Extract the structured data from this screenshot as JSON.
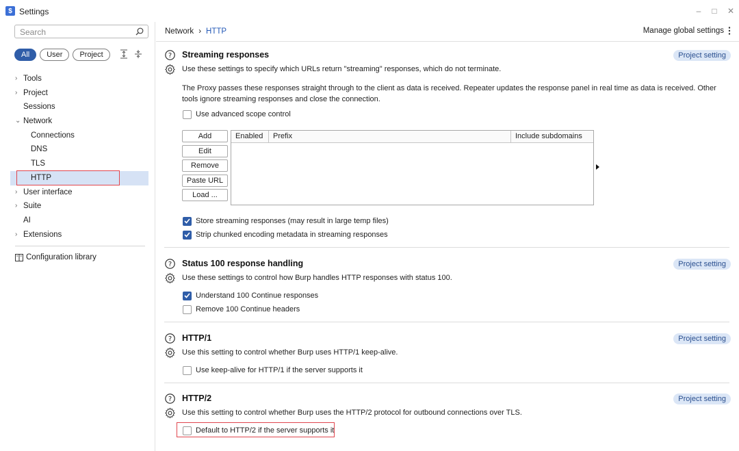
{
  "window": {
    "title": "Settings",
    "app_icon_glyph": "$",
    "app_icon_color": "#3b6fd6",
    "controls": [
      "–",
      "□",
      "✕"
    ]
  },
  "search": {
    "placeholder": "Search"
  },
  "filters": {
    "all": "All",
    "user": "User",
    "project": "Project",
    "active": "All"
  },
  "tree": [
    {
      "label": "Tools",
      "chevron": "›",
      "child": false
    },
    {
      "label": "Project",
      "chevron": "›",
      "child": false
    },
    {
      "label": "Sessions",
      "chevron": "",
      "child": false
    },
    {
      "label": "Network",
      "chevron": "⌄",
      "child": false
    },
    {
      "label": "Connections",
      "chevron": "",
      "child": true
    },
    {
      "label": "DNS",
      "chevron": "",
      "child": true
    },
    {
      "label": "TLS",
      "chevron": "",
      "child": true
    },
    {
      "label": "HTTP",
      "chevron": "",
      "child": true,
      "selected": true
    },
    {
      "label": "User interface",
      "chevron": "›",
      "child": false
    },
    {
      "label": "Suite",
      "chevron": "›",
      "child": false
    },
    {
      "label": "AI",
      "chevron": "",
      "child": false
    },
    {
      "label": "Extensions",
      "chevron": "›",
      "child": false
    }
  ],
  "config_library": "Configuration library",
  "breadcrumb": {
    "parent": "Network",
    "separator": "›",
    "current": "HTTP"
  },
  "manage_global": "Manage global settings",
  "badge": "Project setting",
  "streaming": {
    "title": "Streaming responses",
    "desc": "Use these settings to specify which URLs return \"streaming\" responses, which do not terminate.",
    "para": "The Proxy passes these responses straight through to the client as data is received. Repeater updates the response panel in real time as data is received. Other tools ignore streaming responses and close the connection.",
    "advanced_scope": {
      "label": "Use advanced scope control",
      "checked": false
    },
    "buttons": {
      "add": "Add",
      "edit": "Edit",
      "remove": "Remove",
      "paste_url": "Paste URL",
      "load": "Load ..."
    },
    "table_headers": {
      "enabled": "Enabled",
      "prefix": "Prefix",
      "include_subdomains": "Include subdomains"
    },
    "table_rows": [],
    "store": {
      "label": "Store streaming responses (may result in large temp files)",
      "checked": true
    },
    "strip": {
      "label": "Strip chunked encoding metadata in streaming responses",
      "checked": true
    }
  },
  "status100": {
    "title": "Status 100 response handling",
    "desc": "Use these settings to control how Burp handles HTTP responses with status 100.",
    "understand": {
      "label": "Understand 100 Continue responses",
      "checked": true
    },
    "remove": {
      "label": "Remove 100 Continue headers",
      "checked": false
    }
  },
  "http1": {
    "title": "HTTP/1",
    "desc": "Use this setting to control whether Burp uses HTTP/1 keep-alive.",
    "keepalive": {
      "label": "Use keep-alive for HTTP/1 if the server supports it",
      "checked": false
    }
  },
  "http2": {
    "title": "HTTP/2",
    "desc": "Use this setting to control whether Burp uses the HTTP/2 protocol for outbound connections over TLS.",
    "default": {
      "label": "Default to HTTP/2 if the server supports it",
      "checked": false
    }
  },
  "colors": {
    "accent": "#2f5da8",
    "badge_bg": "#dbe6f6",
    "selected_bg": "#d6e2f5",
    "highlight": "#e0454d"
  }
}
